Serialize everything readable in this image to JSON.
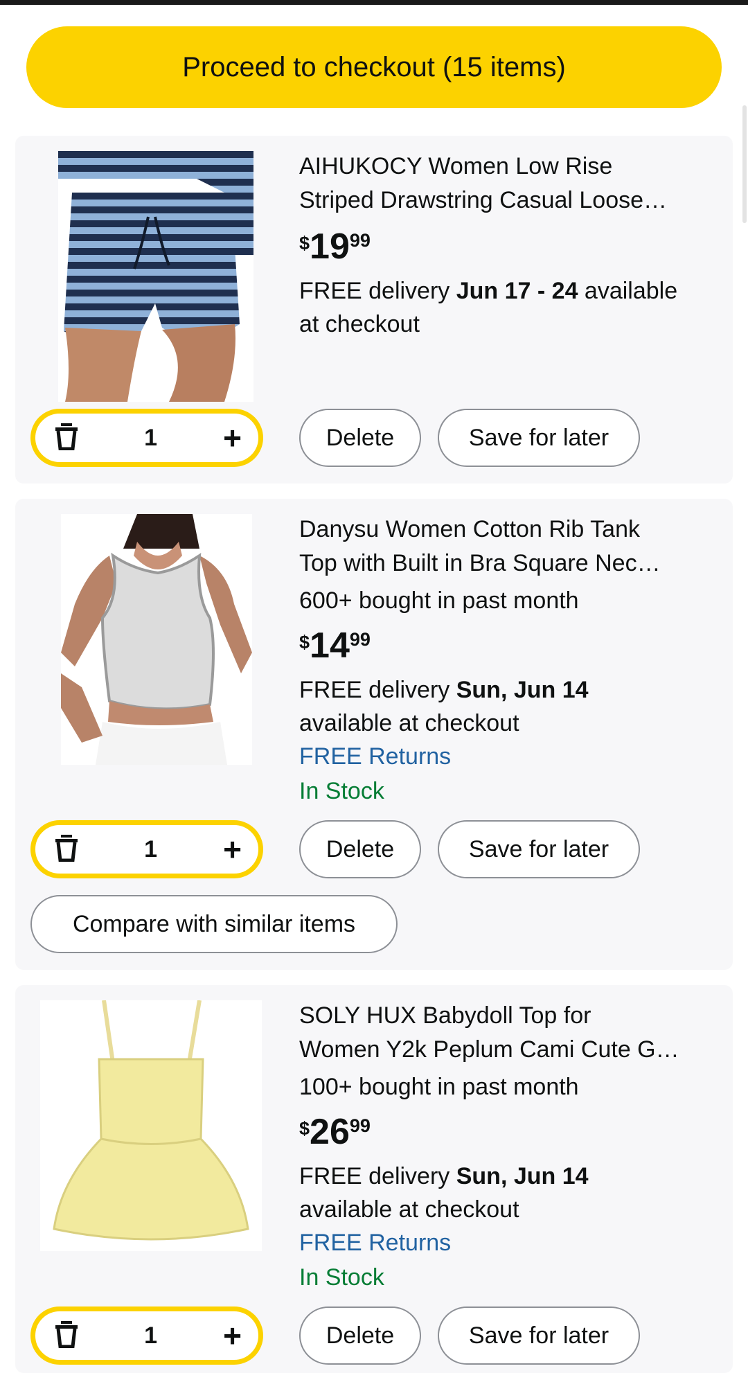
{
  "checkout": {
    "label": "Proceed to checkout (15 items)"
  },
  "items": [
    {
      "title_line1": "AIHUKOCY Women Low Rise",
      "title_line2": "Striped Drawstring Casual Loose…",
      "bought": "",
      "price": {
        "currency": "$",
        "dollars": "19",
        "cents": "99"
      },
      "delivery_prefix": "FREE delivery ",
      "delivery_date": "Jun 17 - 24",
      "delivery_suffix_line1": " available",
      "delivery_suffix_line2": "at checkout",
      "returns": "",
      "stock": "",
      "quantity": "1",
      "delete_label": "Delete",
      "save_label": "Save for later"
    },
    {
      "title_line1": "Danysu Women Cotton Rib Tank",
      "title_line2": "Top with Built in Bra Square Nec…",
      "bought": "600+ bought in past month",
      "price": {
        "currency": "$",
        "dollars": "14",
        "cents": "99"
      },
      "delivery_prefix": "FREE delivery ",
      "delivery_date": "Sun, Jun 14",
      "delivery_suffix_line2": "available at checkout",
      "returns": "FREE Returns",
      "stock": "In Stock",
      "quantity": "1",
      "delete_label": "Delete",
      "save_label": "Save for later",
      "compare_label": "Compare with similar items"
    },
    {
      "title_line1": "SOLY HUX Babydoll Top for",
      "title_line2": "Women Y2k Peplum Cami Cute G…",
      "bought": "100+ bought in past month",
      "price": {
        "currency": "$",
        "dollars": "26",
        "cents": "99"
      },
      "delivery_prefix": "FREE delivery ",
      "delivery_date": "Sun, Jun 14",
      "delivery_suffix_line2": "available at checkout",
      "returns": "FREE Returns",
      "stock": "In Stock",
      "quantity": "1",
      "delete_label": "Delete",
      "save_label": "Save for later"
    }
  ],
  "colors": {
    "accent": "#fcd200",
    "link": "#2162a1",
    "stock": "#067d35"
  },
  "icons": {
    "delete_qty": "trash-icon",
    "increase_qty": "plus-icon"
  }
}
